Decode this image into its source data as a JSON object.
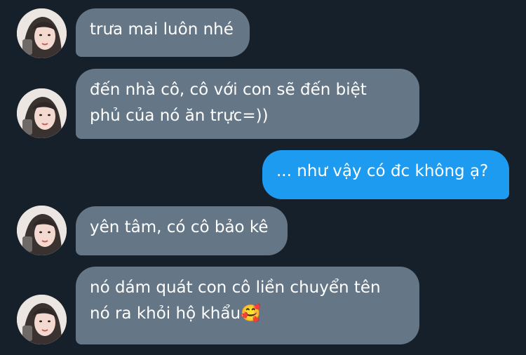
{
  "conversation": {
    "messages": [
      {
        "sender": "other",
        "lines": [
          "trưa mai luôn nhé"
        ]
      },
      {
        "sender": "other",
        "lines": [
          "đến nhà cô, cô với con sẽ đến biệt",
          "phủ của nó ăn trực=))"
        ]
      },
      {
        "sender": "me",
        "lines": [
          "... như vậy có đc không ạ?"
        ]
      },
      {
        "sender": "other",
        "lines": [
          "yên tâm, có cô bảo kê"
        ]
      },
      {
        "sender": "other",
        "lines": [
          "nó dám quát con cô liền chuyển tên",
          "nó ra khỏi hộ khẩu🥰"
        ]
      }
    ]
  },
  "theme": {
    "background": "#16202b",
    "incoming_bubble": "#657686",
    "outgoing_bubble": "#1d9bf0",
    "text": "#ffffff"
  }
}
